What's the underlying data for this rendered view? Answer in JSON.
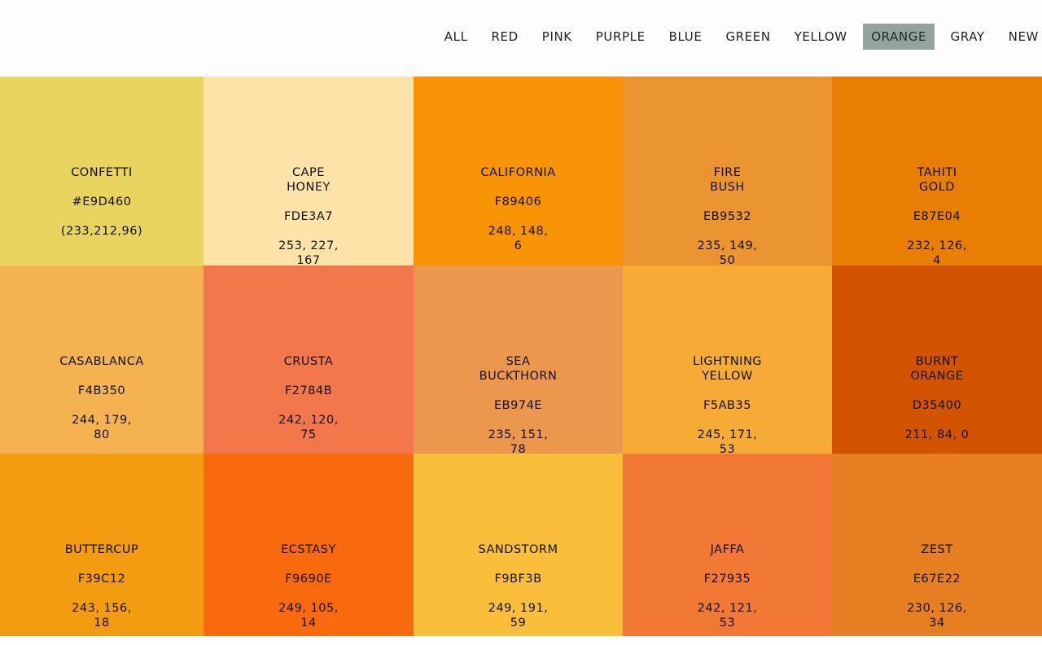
{
  "nav": {
    "items": [
      "ALL",
      "RED",
      "PINK",
      "PURPLE",
      "BLUE",
      "GREEN",
      "YELLOW",
      "ORANGE",
      "GRAY",
      "NEW"
    ],
    "active": "ORANGE"
  },
  "swatches": [
    {
      "name": "CONFETTI",
      "hex": "#E9D460",
      "rgb": "(233,212,96)",
      "color": "#E9D460"
    },
    {
      "name": "CAPE\nHONEY",
      "hex": "FDE3A7",
      "rgb": "253, 227,\n167",
      "color": "#FDE3A7"
    },
    {
      "name": "CALIFORNIA",
      "hex": "F89406",
      "rgb": "248, 148,\n6",
      "color": "#F89406"
    },
    {
      "name": "FIRE\nBUSH",
      "hex": "EB9532",
      "rgb": "235, 149,\n50",
      "color": "#EB9532"
    },
    {
      "name": "TAHITI\nGOLD",
      "hex": "E87E04",
      "rgb": "232, 126,\n4",
      "color": "#E87E04"
    },
    {
      "name": "CASABLANCA",
      "hex": "F4B350",
      "rgb": "244, 179,\n80",
      "color": "#F4B350"
    },
    {
      "name": "CRUSTA",
      "hex": "F2784B",
      "rgb": "242, 120,\n75",
      "color": "#F2784B"
    },
    {
      "name": "SEA\nBUCKTHORN",
      "hex": "EB974E",
      "rgb": "235, 151,\n78",
      "color": "#EB974E"
    },
    {
      "name": "LIGHTNING\nYELLOW",
      "hex": "F5AB35",
      "rgb": "245, 171,\n53",
      "color": "#F5AB35"
    },
    {
      "name": "BURNT\nORANGE",
      "hex": "D35400",
      "rgb": "211, 84, 0",
      "color": "#D35400"
    },
    {
      "name": "BUTTERCUP",
      "hex": "F39C12",
      "rgb": "243, 156,\n18",
      "color": "#F39C12"
    },
    {
      "name": "ECSTASY",
      "hex": "F9690E",
      "rgb": "249, 105,\n14",
      "color": "#F9690E"
    },
    {
      "name": "SANDSTORM",
      "hex": "F9BF3B",
      "rgb": "249, 191,\n59",
      "color": "#F9BF3B"
    },
    {
      "name": "JAFFA",
      "hex": "F27935",
      "rgb": "242, 121,\n53",
      "color": "#F27935"
    },
    {
      "name": "ZEST",
      "hex": "E67E22",
      "rgb": "230, 126,\n34",
      "color": "#E67E22"
    }
  ]
}
